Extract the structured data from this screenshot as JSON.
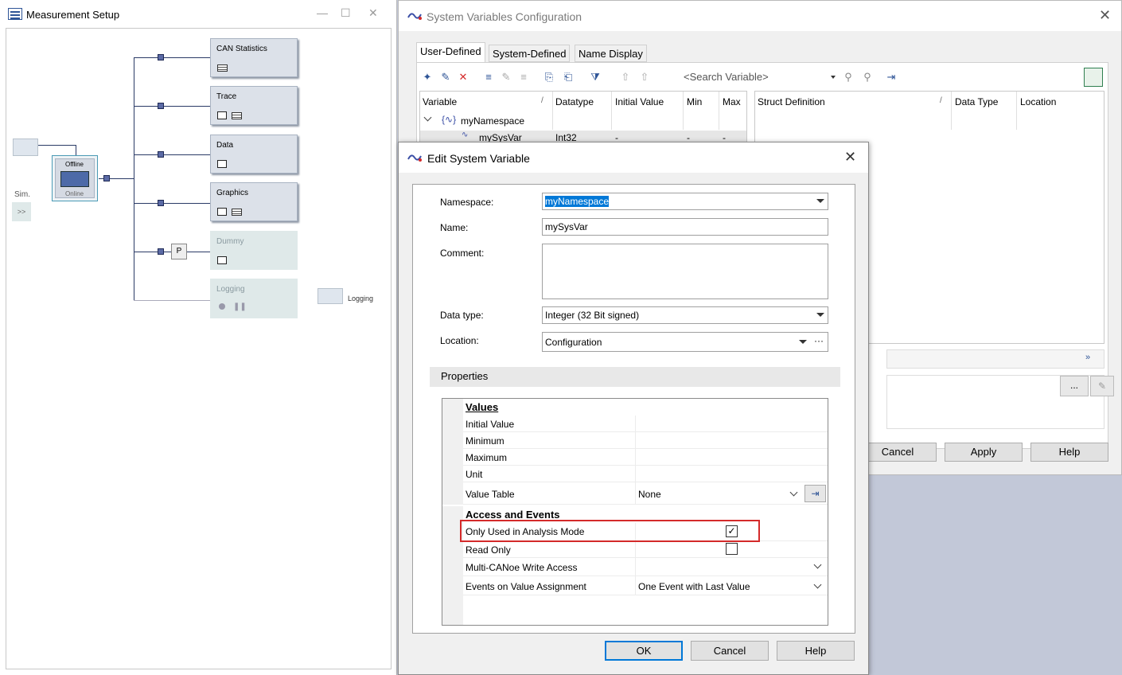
{
  "measurement_setup": {
    "title": "Measurement Setup",
    "blocks": [
      "CAN Statistics",
      "Trace",
      "Data",
      "Graphics",
      "Dummy",
      "Logging"
    ],
    "switch_offline": "Offline",
    "switch_online": "Online",
    "sim_label": "Sim.",
    "sim_button": ">>",
    "p_block": "P",
    "logging_target": "Logging"
  },
  "sysvar_config": {
    "title": "System Variables Configuration",
    "tabs": [
      "User-Defined",
      "System-Defined",
      "Name Display"
    ],
    "search_placeholder": "<Search Variable>",
    "left_columns": [
      "Variable",
      "Datatype",
      "Initial Value",
      "Min",
      "Max"
    ],
    "right_columns": [
      "Struct Definition",
      "Data Type",
      "Location"
    ],
    "tree_namespace": "myNamespace",
    "row": {
      "name": "mySysVar",
      "datatype": "Int32",
      "initial": "-",
      "min": "-",
      "max": "-"
    },
    "buttons": [
      "Cancel",
      "Apply",
      "Help"
    ],
    "ellipsis": "..."
  },
  "edit_dialog": {
    "title": "Edit System Variable",
    "namespace_label": "Namespace:",
    "namespace_value": "myNamespace",
    "name_label": "Name:",
    "name_value": "mySysVar",
    "comment_label": "Comment:",
    "datatype_label": "Data type:",
    "datatype_value": "Integer (32 Bit signed)",
    "location_label": "Location:",
    "location_value": "Configuration",
    "location_more": "···",
    "properties_header": "Properties",
    "cat_values": "Values",
    "initial_value": "Initial Value",
    "minimum": "Minimum",
    "maximum": "Maximum",
    "unit": "Unit",
    "value_table": "Value Table",
    "value_table_value": "None",
    "cat_access": "Access and Events",
    "only_analysis": "Only Used in Analysis Mode",
    "only_analysis_checked": "✓",
    "read_only": "Read Only",
    "multi_canoe": "Multi-CANoe Write Access",
    "events_assign": "Events on Value Assignment",
    "events_assign_value": "One Event with Last Value",
    "buttons": {
      "ok": "OK",
      "cancel": "Cancel",
      "help": "Help"
    }
  }
}
